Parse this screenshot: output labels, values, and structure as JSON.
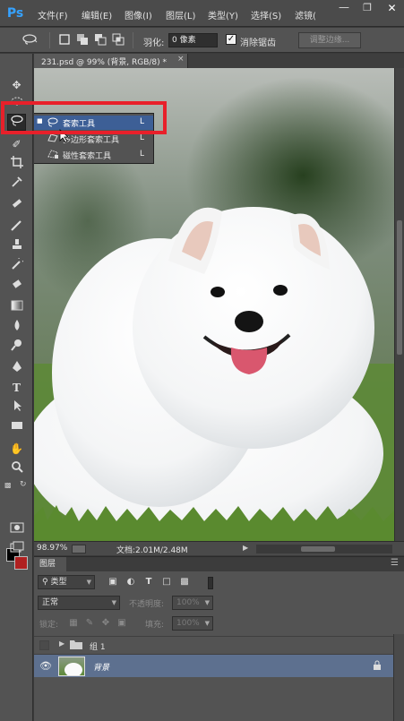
{
  "app": {
    "logo": "Ps",
    "menu": [
      "文件(F)",
      "编辑(E)",
      "图像(I)",
      "图层(L)",
      "类型(Y)",
      "选择(S)",
      "滤镜("
    ],
    "window_controls": [
      "minimize-icon",
      "restore-icon",
      "close-icon"
    ]
  },
  "options_bar": {
    "tool_icon": "lasso-icon",
    "selection_modes": [
      "new-selection-icon",
      "add-selection-icon",
      "subtract-selection-icon",
      "intersect-selection-icon"
    ],
    "feather_label": "羽化:",
    "feather_value": "0 像素",
    "antialias_checked": true,
    "antialias_label": "消除锯齿",
    "refine_edge_label": "调整边缘..."
  },
  "toolbar": {
    "tools": [
      "move-tool-icon",
      "marquee-tool-icon",
      "lasso-tool-icon",
      "quick-select-tool-icon",
      "crop-tool-icon",
      "eyedropper-tool-icon",
      "healing-brush-tool-icon",
      "brush-tool-icon",
      "clone-stamp-tool-icon",
      "history-brush-tool-icon",
      "eraser-tool-icon",
      "gradient-tool-icon",
      "blur-tool-icon",
      "dodge-tool-icon",
      "pen-tool-icon",
      "type-tool-icon",
      "path-select-tool-icon",
      "shape-tool-icon",
      "hand-tool-icon",
      "zoom-tool-icon"
    ],
    "active_tool": "lasso-tool-icon",
    "foreground_color": "#000000",
    "background_color": "#b02020"
  },
  "flyout": {
    "items": [
      {
        "label": "套索工具",
        "shortcut": "L",
        "selected": true,
        "icon": "lasso-icon"
      },
      {
        "label": "多边形套索工具",
        "shortcut": "L",
        "selected": false,
        "icon": "polygonal-lasso-icon"
      },
      {
        "label": "磁性套索工具",
        "shortcut": "L",
        "selected": false,
        "icon": "magnetic-lasso-icon"
      }
    ],
    "highlight_color": "#e8202a"
  },
  "document": {
    "tab_title": "231.psd @ 99% (背景, RGB/8) *",
    "zoom": "98.97%",
    "doc_size": "文档:2.01M/2.48M"
  },
  "layers_panel": {
    "tab_label": "图层",
    "filter_kind": "类型",
    "blend_mode": "正常",
    "opacity_label": "不透明度:",
    "opacity_value": "100%",
    "lock_label": "锁定:",
    "fill_label": "填充:",
    "fill_value": "100%",
    "layers": [
      {
        "name": "组 1",
        "type": "group",
        "visible": false,
        "selected": false
      },
      {
        "name": "背景",
        "type": "image",
        "visible": true,
        "selected": true,
        "locked": true
      }
    ]
  }
}
